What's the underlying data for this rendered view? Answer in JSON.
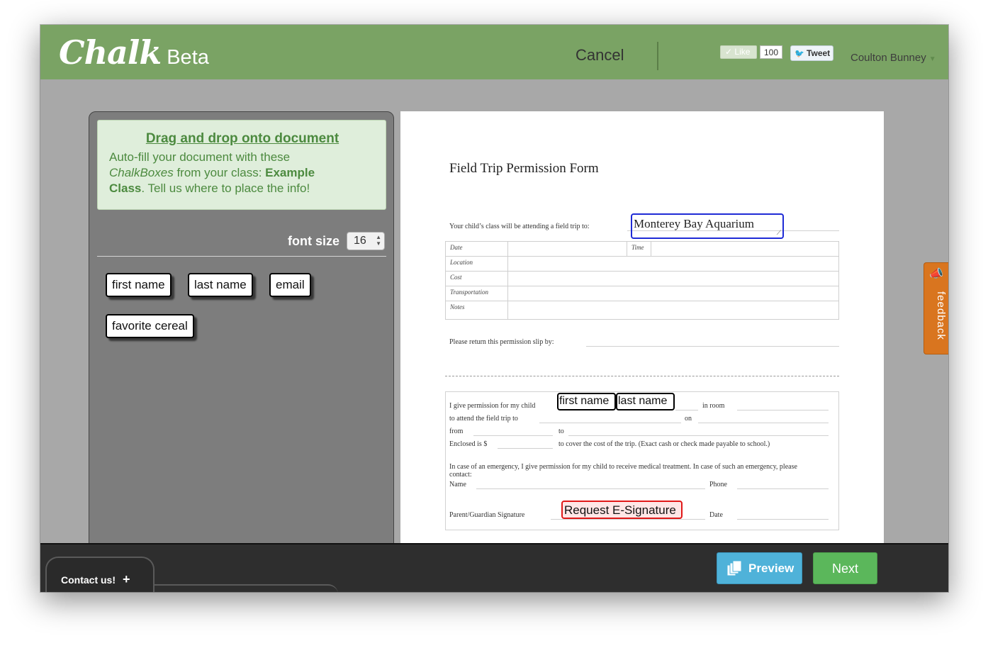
{
  "header": {
    "logo_main": "Chalk",
    "logo_sub": "Beta",
    "cancel_label": "Cancel",
    "like_label": "✓ Like",
    "like_count": "100",
    "tweet_label": "Tweet",
    "user_name": "Coulton Bunney"
  },
  "panel": {
    "info_title": "Drag and drop onto document",
    "info_line1": "Auto-fill your document with these",
    "info_chalkboxes": "ChalkBoxes",
    "info_from_class": " from your class: ",
    "info_class_name1": "Example",
    "info_class_name2": "Class",
    "info_tail": ". Tell us where to place the info!",
    "font_size_label": "font size",
    "font_size_value": "16",
    "chalkboxes": [
      "first name",
      "last name",
      "email",
      "favorite cereal"
    ]
  },
  "document": {
    "title": "Field Trip Permission Form",
    "intro": "Your child’s class will be attending a field trip to:",
    "destination": "Monterey Bay Aquarium",
    "rows": [
      "Date",
      "Location",
      "Cost",
      "Transportation",
      "Notes"
    ],
    "time_label": "Time",
    "return_label": "Please return this permission slip by:",
    "perm_line1": "I give permission for my child",
    "chip_first": "first name",
    "chip_last": "last name",
    "in_room": "in room",
    "attend_label": "to attend the field trip to",
    "on_label": "on",
    "from_label": "from",
    "to_label": "to",
    "enclosed_label": "Enclosed is $",
    "cost_label": "to cover the cost of the trip. (Exact cash or check made payable to school.)",
    "emergency_text": "In case of an emergency, I give permission for my child to receive medical treatment. In case of such an emergency, please contact:",
    "name_label": "Name",
    "phone_label": "Phone",
    "signature_label": "Parent/Guardian Signature",
    "signature_request": "Request E-Signature",
    "date_label": "Date"
  },
  "feedback_label": "feedback",
  "footer": {
    "contact_label": "Contact us!",
    "contact_plus": "+",
    "preview_label": "Preview",
    "next_label": "Next"
  },
  "colors": {
    "header_green": "#7aa364",
    "destination_border": "#1f2bd6",
    "signature_border": "#e01818",
    "preview_blue": "#4fb2d9",
    "next_green": "#5bb75b",
    "feedback_orange": "#d9751f"
  }
}
